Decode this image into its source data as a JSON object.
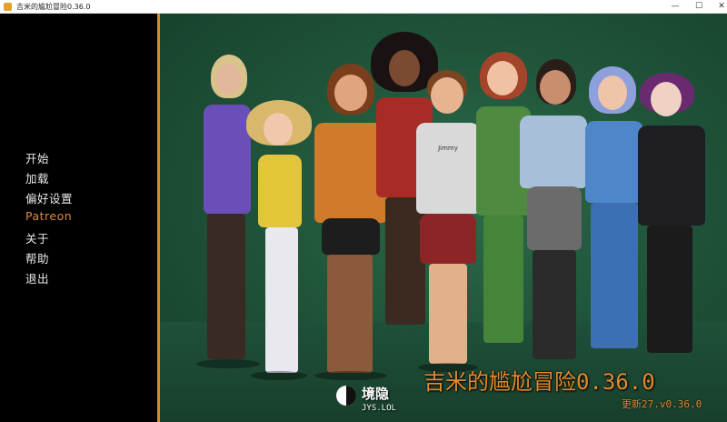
{
  "window": {
    "title": "吉米的尴尬冒险0.36.0",
    "controls": {
      "minimize": "—",
      "maximize": "☐",
      "close": "✕"
    }
  },
  "menu": {
    "items": [
      {
        "label": "开始",
        "highlighted": false
      },
      {
        "label": "加载",
        "highlighted": false
      },
      {
        "label": "偏好设置",
        "highlighted": false
      },
      {
        "label": "Patreon",
        "highlighted": true
      },
      {
        "label": "关于",
        "highlighted": false
      },
      {
        "label": "帮助",
        "highlighted": false
      },
      {
        "label": "退出",
        "highlighted": false
      }
    ]
  },
  "game": {
    "title": "吉米的尴尬冒险0.36.0",
    "version": "更新27.v0.36.0",
    "shirt_text": "Jimmy"
  },
  "watermark": {
    "text": "境隐",
    "sub": "JYS.LOL"
  },
  "colors": {
    "accent": "#e0893a",
    "background": "#20553a",
    "menu_text": "#e9e9e9",
    "menu_border": "#cf8a3c"
  }
}
